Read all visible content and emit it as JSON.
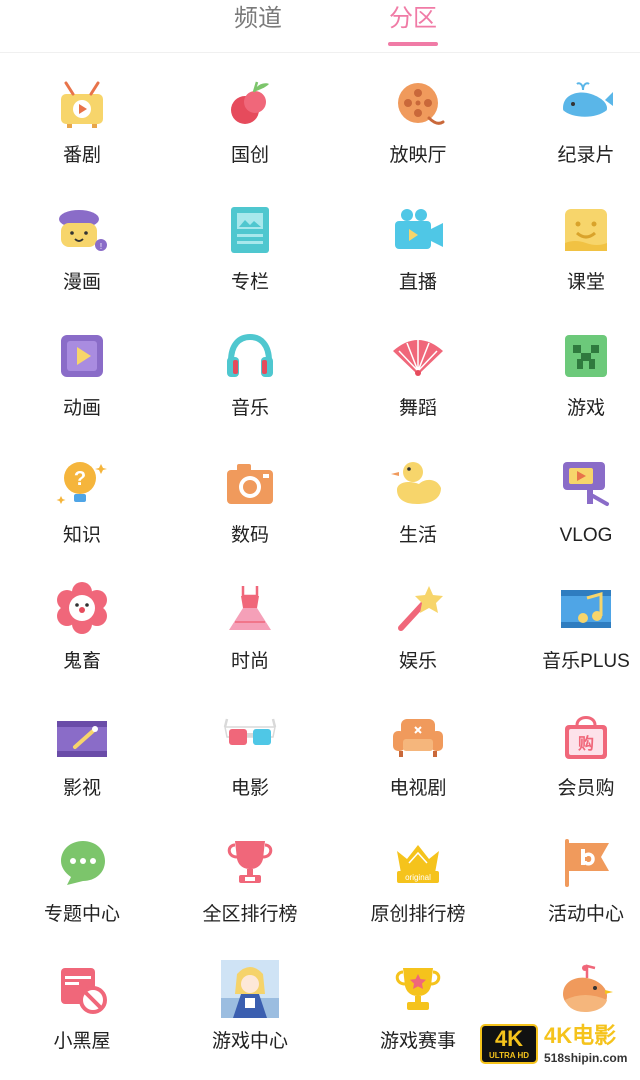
{
  "header": {
    "tabs": [
      {
        "label": "频道",
        "active": false
      },
      {
        "label": "分区",
        "active": true
      }
    ],
    "accent": "#f07ba6"
  },
  "categories": [
    {
      "label": "番剧",
      "icon": "tv-icon"
    },
    {
      "label": "国创",
      "icon": "peach-icon"
    },
    {
      "label": "放映厅",
      "icon": "film-reel-icon"
    },
    {
      "label": "纪录片",
      "icon": "whale-icon"
    },
    {
      "label": "漫画",
      "icon": "beret-comic-icon"
    },
    {
      "label": "专栏",
      "icon": "article-icon"
    },
    {
      "label": "直播",
      "icon": "video-camera-icon"
    },
    {
      "label": "课堂",
      "icon": "smile-block-icon"
    },
    {
      "label": "动画",
      "icon": "play-square-icon"
    },
    {
      "label": "音乐",
      "icon": "headphones-icon"
    },
    {
      "label": "舞蹈",
      "icon": "fan-icon"
    },
    {
      "label": "游戏",
      "icon": "creeper-icon"
    },
    {
      "label": "知识",
      "icon": "lightbulb-question-icon"
    },
    {
      "label": "数码",
      "icon": "camera-icon"
    },
    {
      "label": "生活",
      "icon": "duck-icon"
    },
    {
      "label": "VLOG",
      "icon": "vlog-camera-icon"
    },
    {
      "label": "鬼畜",
      "icon": "clown-icon"
    },
    {
      "label": "时尚",
      "icon": "dress-icon"
    },
    {
      "label": "娱乐",
      "icon": "magic-wand-icon"
    },
    {
      "label": "音乐PLUS",
      "icon": "music-note-film-icon"
    },
    {
      "label": "影视",
      "icon": "film-clapper-icon"
    },
    {
      "label": "电影",
      "icon": "3d-glasses-icon"
    },
    {
      "label": "电视剧",
      "icon": "sofa-icon"
    },
    {
      "label": "会员购",
      "icon": "shopping-bag-icon"
    },
    {
      "label": "专题中心",
      "icon": "chat-bubble-icon"
    },
    {
      "label": "全区排行榜",
      "icon": "trophy-cup-icon"
    },
    {
      "label": "原创排行榜",
      "icon": "original-crown-icon"
    },
    {
      "label": "活动中心",
      "icon": "bilibili-flag-icon"
    },
    {
      "label": "小黑屋",
      "icon": "ban-calendar-icon"
    },
    {
      "label": "游戏中心",
      "icon": "anime-thumbnail-icon"
    },
    {
      "label": "游戏赛事",
      "icon": "star-trophy-icon"
    },
    {
      "label": "",
      "icon": "bird-icon"
    }
  ],
  "watermark": {
    "badge_main": "4K",
    "badge_sub": "ULTRA HD",
    "title": "4K电影",
    "url": "518shipin.com"
  }
}
